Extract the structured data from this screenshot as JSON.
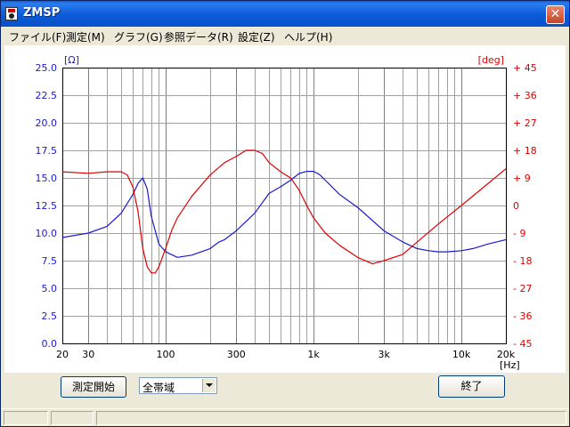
{
  "window": {
    "title": "ZMSP",
    "close_glyph": "✕"
  },
  "menu": [
    "ファイル(F)",
    "測定(M)",
    "グラフ(G)",
    "参照データ(R)",
    "設定(Z)",
    "ヘルプ(H)"
  ],
  "buttons": {
    "start_measure": "測定開始",
    "exit": "終了"
  },
  "range_select": {
    "selected": "全帯域"
  },
  "colors": {
    "impedance": "#1a1ad0",
    "phase": "#e00000",
    "grid": "#a0a0a0",
    "frame": "#000000"
  },
  "chart_data": {
    "type": "line",
    "x_scale": "log",
    "xlim": [
      20,
      20000
    ],
    "x_ticks": [
      {
        "value": 20,
        "label": "20"
      },
      {
        "value": 30,
        "label": "30"
      },
      {
        "value": 100,
        "label": "100"
      },
      {
        "value": 300,
        "label": "300"
      },
      {
        "value": 1000,
        "label": "1k"
      },
      {
        "value": 3000,
        "label": "3k"
      },
      {
        "value": 10000,
        "label": "10k"
      },
      {
        "value": 20000,
        "label": "20k"
      }
    ],
    "xlabel": "[Hz]",
    "left_axis": {
      "label": "[Ω]",
      "ylim": [
        0,
        25
      ],
      "ticks": [
        "0.0",
        "2.5",
        "5.0",
        "7.5",
        "10.0",
        "12.5",
        "15.0",
        "17.5",
        "20.0",
        "22.5",
        "25.0"
      ]
    },
    "right_axis": {
      "label": "[deg]",
      "ylim": [
        -45,
        45
      ],
      "ticks": [
        "- 45",
        "- 36",
        "- 27",
        "- 18",
        "- 9",
        "0",
        "+ 9",
        "+ 18",
        "+ 27",
        "+ 36",
        "+ 45"
      ]
    },
    "grid": true,
    "series": [
      {
        "axis": "left",
        "x": [
          20,
          30,
          40,
          50,
          60,
          65,
          70,
          75,
          80,
          90,
          100,
          120,
          150,
          200,
          230,
          250,
          300,
          400,
          500,
          600,
          700,
          800,
          900,
          1000,
          1100,
          1200,
          1500,
          2000,
          3000,
          4000,
          5000,
          6000,
          7000,
          8000,
          10000,
          12000,
          15000,
          20000
        ],
        "y": [
          9.6,
          10.0,
          10.6,
          11.8,
          13.5,
          14.5,
          15.0,
          14.0,
          11.5,
          9.0,
          8.3,
          7.8,
          8.0,
          8.6,
          9.2,
          9.4,
          10.2,
          11.8,
          13.6,
          14.2,
          14.8,
          15.4,
          15.6,
          15.6,
          15.3,
          14.8,
          13.5,
          12.3,
          10.2,
          9.2,
          8.6,
          8.4,
          8.3,
          8.3,
          8.4,
          8.6,
          9.0,
          9.4
        ]
      },
      {
        "axis": "right",
        "x": [
          20,
          30,
          40,
          50,
          55,
          60,
          65,
          70,
          75,
          80,
          85,
          90,
          100,
          110,
          120,
          150,
          200,
          250,
          300,
          350,
          400,
          450,
          500,
          600,
          700,
          800,
          900,
          1000,
          1200,
          1500,
          2000,
          2500,
          3000,
          4000,
          5000,
          7000,
          10000,
          15000,
          20000
        ],
        "y": [
          11,
          10.5,
          11,
          11,
          10,
          6,
          -2,
          -14,
          -20,
          -22,
          -22,
          -20,
          -14,
          -8,
          -4,
          3,
          10,
          14,
          16,
          18,
          18,
          17,
          14,
          11,
          9,
          5,
          0,
          -4,
          -9,
          -13,
          -17,
          -19,
          -18,
          -16,
          -12,
          -6,
          0,
          7,
          12
        ]
      }
    ]
  }
}
